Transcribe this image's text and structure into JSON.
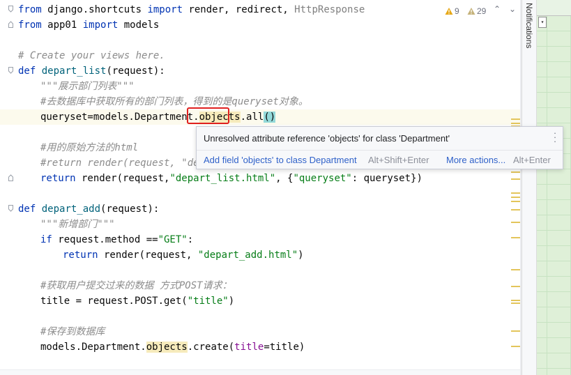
{
  "editor": {
    "lines": {
      "l1": {
        "kw1": "from",
        "mod": " django.shortcuts ",
        "kw2": "import",
        "names": " render, redirect, ",
        "unused": "HttpResponse"
      },
      "l2": {
        "kw1": "from",
        "mod": " app01 ",
        "kw2": "import",
        "names": " models"
      },
      "l4": {
        "comment": "# Create your views here."
      },
      "l5": {
        "kw": "def",
        "sp": " ",
        "fn": "depart_list",
        "rest": "(request):"
      },
      "l6": {
        "doc": "\"\"\"展示部门列表\"\"\""
      },
      "l7": {
        "comment": "#去数据库中获取所有的部门列表，得到的是queryset对象。"
      },
      "l8": {
        "pre": "queryset=models.Department.",
        "obj": "objects",
        ".all": ".all",
        "paren": "()"
      },
      "l10": {
        "comment": "#用的原始方法的html"
      },
      "l11": {
        "comment": "#return render(request, \"dep"
      },
      "l12": {
        "kw": "return",
        "mid": " render(request,",
        "s1": "\"depart_list.html\"",
        "mid2": ", {",
        "s2": "\"queryset\"",
        "tail": ": queryset})"
      },
      "l14": {
        "kw": "def",
        "sp": " ",
        "fn": "depart_add",
        "rest": "(request):"
      },
      "l15": {
        "doc": "\"\"\"新增部门\"\"\""
      },
      "l16": {
        "kw": "if",
        "mid": " request.method ==",
        "s1": "\"GET\"",
        "tail": ":"
      },
      "l17": {
        "kw": "return",
        "mid": " render(request, ",
        "s1": "\"depart_add.html\"",
        "tail": ")"
      },
      "l19": {
        "comment": "#获取用户提交过来的数据 方式POST请求："
      },
      "l20": {
        "mid": "title = request.POST.get(",
        "s1": "\"title\"",
        "tail": ")"
      },
      "l22": {
        "comment": "#保存到数据库"
      },
      "l23": {
        "pre": "models.Department.",
        "obj": "objects",
        "mid": ".create(",
        "param": "title",
        "tail": "=title)"
      }
    }
  },
  "inspections": {
    "warnings_count": "9",
    "weak_warnings_count": "29",
    "warning_color": "#e6a817"
  },
  "side_panel": {
    "notifications_label": "Notifications"
  },
  "popup": {
    "message": "Unresolved attribute reference 'objects' for class 'Department'",
    "action1": "Add field 'objects' to class Department",
    "shortcut1": "Alt+Shift+Enter",
    "action2": "More actions...",
    "shortcut2": "Alt+Enter"
  },
  "colors": {
    "keyword": "#0033b3",
    "string": "#067d17",
    "comment": "#8c8c8c",
    "highlight_box": "#e0201f"
  }
}
